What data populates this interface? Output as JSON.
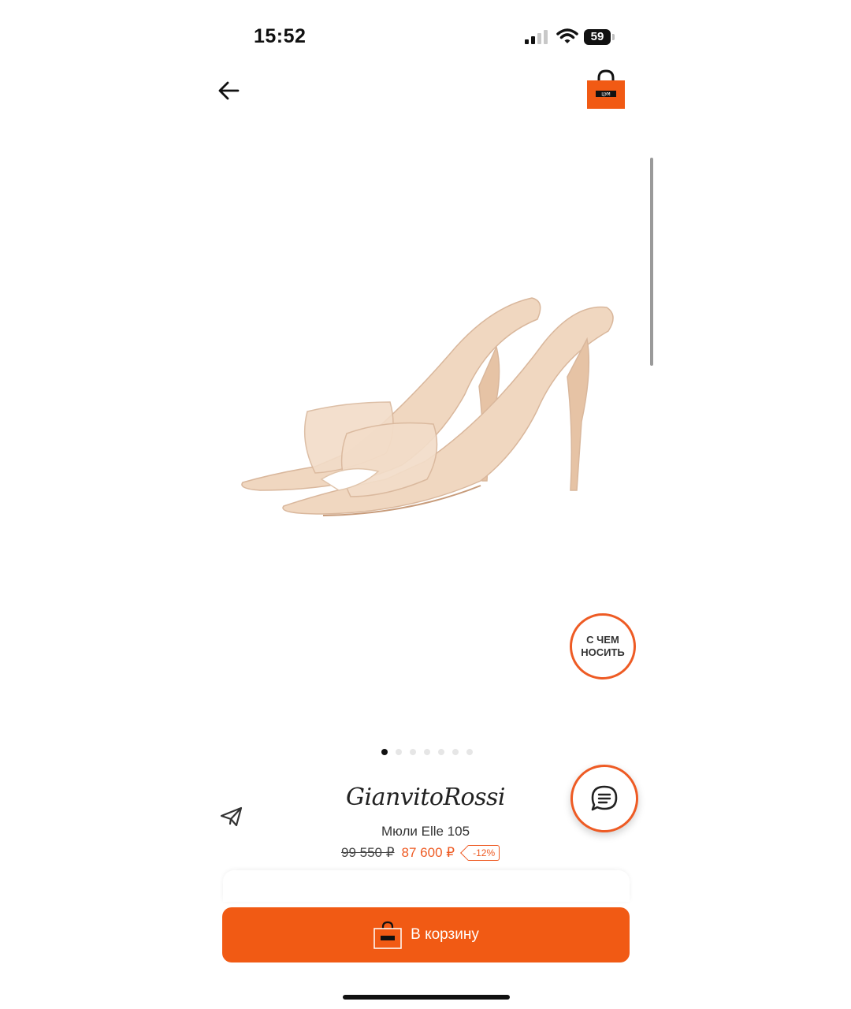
{
  "status_bar": {
    "time": "15:52",
    "battery": "59"
  },
  "header": {
    "back_icon": "arrow-left-icon",
    "bag_icon": "shopping-bag-icon"
  },
  "gallery": {
    "total_slides": 7,
    "active_slide": 1
  },
  "wear_with": {
    "line1": "С ЧЕМ",
    "line2": "НОСИТЬ"
  },
  "product": {
    "brand": "GianvitoRossi",
    "name": "Мюли Elle 105",
    "old_price": "99 550 ₽",
    "price": "87 600 ₽",
    "discount": "-12%"
  },
  "cart_button": {
    "label": "В корзину"
  },
  "colors": {
    "accent": "#f15a14",
    "accent_outline": "#ee5b24",
    "shoe": "#f0d7c0"
  }
}
